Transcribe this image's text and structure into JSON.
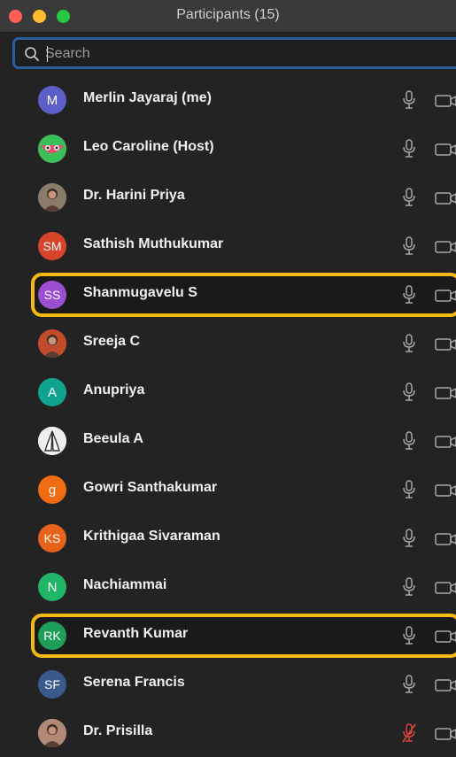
{
  "window": {
    "title": "Participants (15)"
  },
  "search": {
    "placeholder": "Search"
  },
  "participants": [
    {
      "name": "Merlin Jayaraj (me)",
      "initials": "M",
      "avatar_color": "#5b5fc7",
      "avatar_type": "initials",
      "mic": "on"
    },
    {
      "name": "Leo Caroline (Host)",
      "initials": "",
      "avatar_color": "#e54b6a",
      "avatar_type": "watermelon-picture",
      "mic": "on"
    },
    {
      "name": "Dr. Harini Priya",
      "initials": "",
      "avatar_color": "#8a7a6a",
      "avatar_type": "photo",
      "mic": "on"
    },
    {
      "name": "Sathish Muthukumar",
      "initials": "SM",
      "avatar_color": "#d9452b",
      "avatar_type": "initials",
      "mic": "on"
    },
    {
      "name": "Shanmugavelu S",
      "initials": "SS",
      "avatar_color": "#9a4fd0",
      "avatar_type": "initials",
      "mic": "on",
      "highlighted": true
    },
    {
      "name": "Sreeja C",
      "initials": "",
      "avatar_color": "#c24b2c",
      "avatar_type": "photo",
      "mic": "on"
    },
    {
      "name": "Anupriya",
      "initials": "A",
      "avatar_color": "#10a38f",
      "avatar_type": "initials",
      "mic": "on"
    },
    {
      "name": "Beeula A",
      "initials": "",
      "avatar_color": "#e8e8e8",
      "avatar_type": "praying-hands-picture",
      "mic": "on"
    },
    {
      "name": "Gowri Santhakumar",
      "initials": "g",
      "avatar_color": "#ef6c13",
      "avatar_type": "initials",
      "mic": "on"
    },
    {
      "name": "Krithigaa Sivaraman",
      "initials": "KS",
      "avatar_color": "#e8631a",
      "avatar_type": "initials",
      "mic": "on"
    },
    {
      "name": "Nachiammai",
      "initials": "N",
      "avatar_color": "#21b568",
      "avatar_type": "initials",
      "mic": "on"
    },
    {
      "name": "Revanth Kumar",
      "initials": "RK",
      "avatar_color": "#1f9e58",
      "avatar_type": "initials",
      "mic": "on",
      "highlighted": true
    },
    {
      "name": "Serena Francis",
      "initials": "SF",
      "avatar_color": "#3b5a8c",
      "avatar_type": "initials",
      "mic": "on"
    },
    {
      "name": "Dr. Prisilla",
      "initials": "",
      "avatar_color": "#b08a76",
      "avatar_type": "photo",
      "mic": "muted"
    }
  ],
  "colors": {
    "highlight": "#f5b913",
    "muted_mic": "#e0453f",
    "accent": "#2c5f9e"
  }
}
